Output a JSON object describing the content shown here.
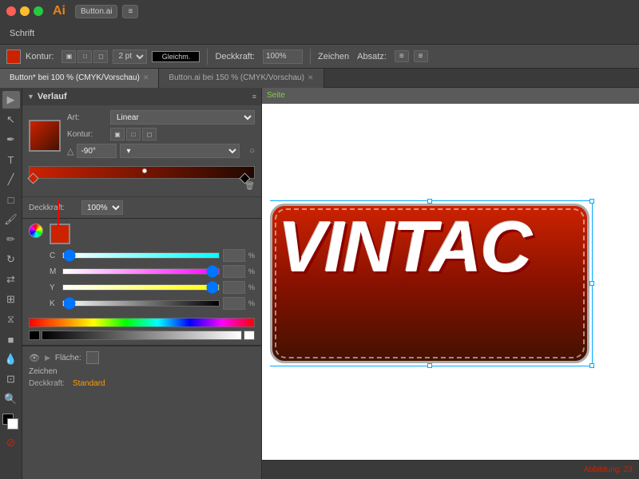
{
  "app": {
    "title": "Adobe Illustrator",
    "icon": "Ai"
  },
  "titlebar": {
    "buttons": [
      "close",
      "minimize",
      "maximize"
    ],
    "file_btn": "Button.ai",
    "nav_btn": "≡"
  },
  "menubar": {
    "items": [
      "Schrift"
    ]
  },
  "toolbar": {
    "label": "",
    "stroke_label": "Kontur:",
    "stroke_width": "2 pt",
    "stroke_style": "Gleichm.",
    "opacity_label": "Deckkraft:",
    "opacity_value": "100%",
    "char_label": "Zeichen",
    "para_label": "Absatz:"
  },
  "tabs": [
    {
      "label": "Button* bei 100 % (CMYK/Vorschau)",
      "active": true
    },
    {
      "label": "Button.ai bei 150 % (CMYK/Vorschau)",
      "active": false
    }
  ],
  "verlauf_panel": {
    "title": "Verlauf",
    "art_label": "Art:",
    "art_value": "Linear",
    "kontur_label": "Kontur:",
    "angle_value": "-90°",
    "opacity_label": "Deckkraft:",
    "opacity_value": "100%"
  },
  "color_panel": {
    "channels": [
      {
        "label": "C",
        "value": "0",
        "pct": "%",
        "slider_type": "cyan"
      },
      {
        "label": "M",
        "value": "100",
        "pct": "%",
        "slider_type": "magenta"
      },
      {
        "label": "Y",
        "value": "100",
        "pct": "%",
        "slider_type": "yellow"
      },
      {
        "label": "K",
        "value": "0",
        "pct": "%",
        "slider_type": "black"
      }
    ]
  },
  "bottom_section": {
    "flaeche_label": "Fläche:",
    "zeichen_label": "Zeichen",
    "deckkraft_label": "Deckkraft:",
    "deckkraft_value": "Standard"
  },
  "canvas": {
    "site_label": "Seite",
    "figure_label": "Abbildung: 23",
    "vintage_text": "VINTAC"
  }
}
